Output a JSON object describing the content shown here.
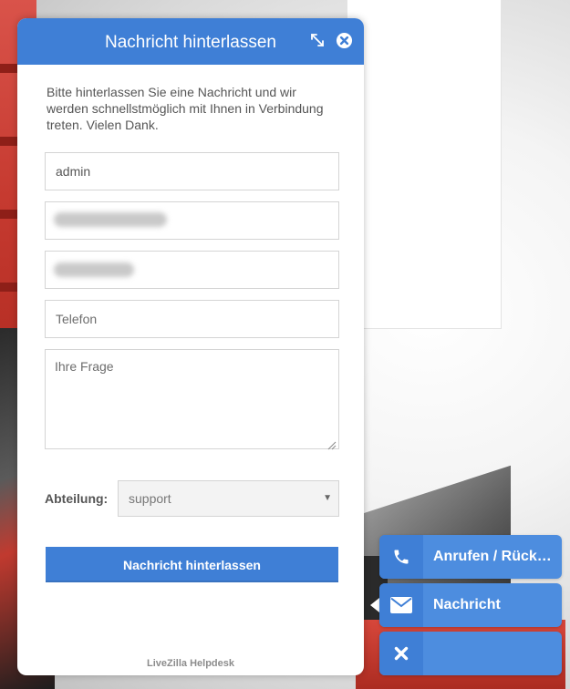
{
  "colors": {
    "accent": "#3f7fd6",
    "side_button": "#4d8ddf",
    "text": "#555555"
  },
  "widget": {
    "title": "Nachricht hinterlassen",
    "header_icons": [
      "expand-icon",
      "close-icon"
    ],
    "intro_text": "Bitte hinterlassen Sie eine Nachricht und wir werden schnellstmöglich mit Ihnen in Verbindung treten. Vielen Dank.",
    "fields": {
      "name_value": "admin",
      "phone_placeholder": "Telefon",
      "question_placeholder": "Ihre Frage"
    },
    "department": {
      "label": "Abteilung:",
      "selected": "support"
    },
    "submit_label": "Nachricht hinterlassen",
    "footer": "LiveZilla Helpdesk"
  },
  "side_buttons": [
    {
      "icon": "phone-icon",
      "label": "Anrufen / Rück…"
    },
    {
      "icon": "envelope-icon",
      "label": "Nachricht"
    },
    {
      "icon": "close-icon",
      "label": ""
    }
  ]
}
